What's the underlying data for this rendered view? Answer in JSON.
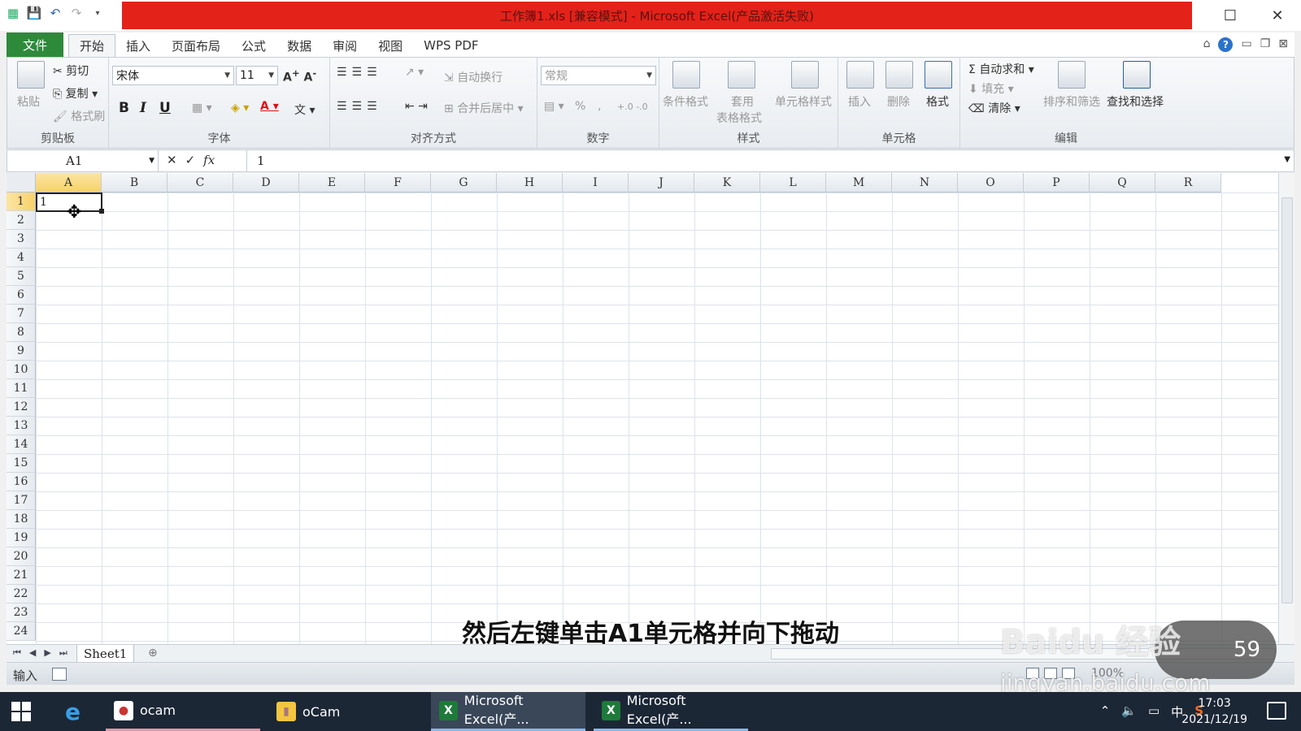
{
  "window": {
    "title": "工作簿1.xls  [兼容模式] - Microsoft Excel(产品激活失败)",
    "controls": {
      "minimize": "—",
      "maximize": "☐",
      "close": "✕"
    }
  },
  "ribbon_tabs": [
    {
      "label": "文件"
    },
    {
      "label": "开始"
    },
    {
      "label": "插入"
    },
    {
      "label": "页面布局"
    },
    {
      "label": "公式"
    },
    {
      "label": "数据"
    },
    {
      "label": "审阅"
    },
    {
      "label": "视图"
    },
    {
      "label": "WPS PDF"
    }
  ],
  "ribbon": {
    "clipboard": {
      "paste": "粘贴",
      "cut": "剪切",
      "copy": "复制",
      "format_painter": "格式刷",
      "label": "剪贴板"
    },
    "font": {
      "name": "宋体",
      "size": "11",
      "bold": "B",
      "italic": "I",
      "underline": "U",
      "label": "字体"
    },
    "alignment": {
      "wrap": "自动换行",
      "merge": "合并后居中",
      "label": "对齐方式"
    },
    "number": {
      "format": "常规",
      "percent": "%",
      "comma": ",",
      "label": "数字"
    },
    "styles": {
      "conditional": "条件格式",
      "table1": "套用",
      "table2": "表格格式",
      "cell_styles": "单元格样式",
      "label": "样式"
    },
    "cells": {
      "insert": "插入",
      "delete": "删除",
      "format": "格式",
      "label": "单元格"
    },
    "editing": {
      "autosum": "自动求和",
      "fill": "填充",
      "clear": "清除",
      "sort": "排序和筛选",
      "find": "查找和选择",
      "label": "编辑"
    }
  },
  "formula_bar": {
    "name_box": "A1",
    "value": "1",
    "fx": "fx"
  },
  "grid": {
    "columns": [
      "A",
      "B",
      "C",
      "D",
      "E",
      "F",
      "G",
      "H",
      "I",
      "J",
      "K",
      "L",
      "M",
      "N",
      "O",
      "P",
      "Q",
      "R"
    ],
    "rows": [
      "1",
      "2",
      "3",
      "4",
      "5",
      "6",
      "7",
      "8",
      "9",
      "10",
      "11",
      "12",
      "13",
      "14",
      "15",
      "16",
      "17",
      "18",
      "19",
      "20",
      "21",
      "22",
      "23",
      "24"
    ],
    "active_cell_value": "1"
  },
  "sheet_tabs": {
    "active": "Sheet1"
  },
  "status": {
    "mode": "输入",
    "zoom": "100%"
  },
  "subtitle": "然后左键单击A1单元格并向下拖动",
  "watermark": {
    "brand": "Baidu 经验",
    "url": "jingyan.baidu.com",
    "badge": "59"
  },
  "taskbar": {
    "items": [
      {
        "label": "ocam"
      },
      {
        "label": "oCam"
      },
      {
        "label": "Microsoft Excel(产..."
      },
      {
        "label": "Microsoft Excel(产..."
      }
    ],
    "tray_ime": "中",
    "time": "17:03",
    "date": "2021/12/19"
  }
}
